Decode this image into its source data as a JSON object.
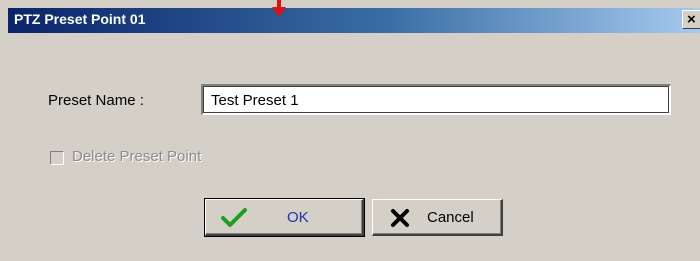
{
  "window": {
    "title": "PTZ Preset Point 01",
    "close_glyph": "×"
  },
  "form": {
    "preset_name_label": "Preset Name :",
    "preset_name_value": "Test Preset 1",
    "delete_label": "Delete Preset Point",
    "delete_checked": false,
    "delete_enabled": false
  },
  "buttons": {
    "ok_label": "OK",
    "cancel_label": "Cancel"
  },
  "colors": {
    "titlebar_start": "#0a246a",
    "titlebar_end": "#a6caf0",
    "dialog_bg": "#d4d0c8",
    "ok_text": "#1c30b4",
    "check_icon": "#1e9e1e",
    "pointer_arrow": "#e01010"
  },
  "icons": {
    "ok": "check-icon",
    "cancel": "x-icon",
    "close": "close-icon",
    "pointer": "pointer-arrow-icon"
  }
}
